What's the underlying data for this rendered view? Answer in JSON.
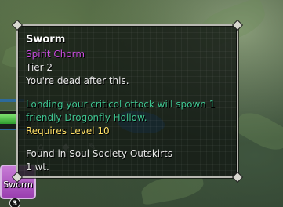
{
  "tooltip": {
    "title": "Sworm",
    "type": "Spirit Chorm",
    "tier": "Tier 2",
    "flavor": "You're dead after this.",
    "effect_line1": "Londing your criticol ottock will spown 1",
    "effect_line2": "friendly Drogonfly Hollow.",
    "requirement": "Requires Level 10",
    "found": "Found in Soul Society Outskirts",
    "weight": "1 wt."
  },
  "inventory_slot": {
    "label": "Sworm",
    "count": "3",
    "color": "#b45cc6"
  },
  "colors": {
    "title": "#ffffff",
    "type": "#c64bdc",
    "effect": "#3fc38f",
    "requirement": "#ffe066",
    "border": "#b9b9b2"
  }
}
